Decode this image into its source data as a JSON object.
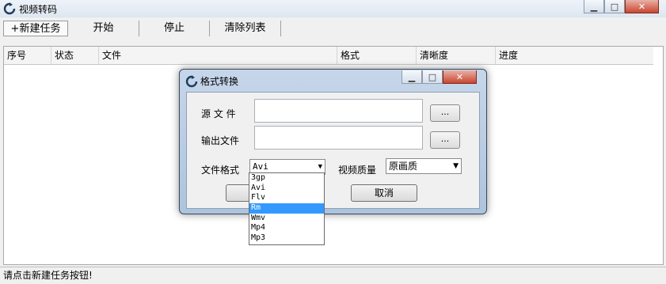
{
  "app": {
    "title": "视频转码"
  },
  "toolbar": {
    "new_task": "+新建任务",
    "start": "开始",
    "stop": "停止",
    "clear": "清除列表"
  },
  "grid": {
    "columns": [
      "序号",
      "状态",
      "文件",
      "格式",
      "清晰度",
      "进度"
    ]
  },
  "status": {
    "text": "请点击新建任务按钮!"
  },
  "dialog": {
    "title": "格式转换",
    "source_label": "源 文 件",
    "output_label": "输出文件",
    "browse_label": "...",
    "format_label": "文件格式",
    "format_value": "Avi",
    "quality_label": "视频质量",
    "quality_value": "原画质",
    "cancel_label": "取消"
  },
  "dropdown": {
    "options": [
      "3gp",
      "Avi",
      "Flv",
      "Rm",
      "Wmv",
      "Mp4",
      "Mp3"
    ],
    "selected": "Rm"
  }
}
